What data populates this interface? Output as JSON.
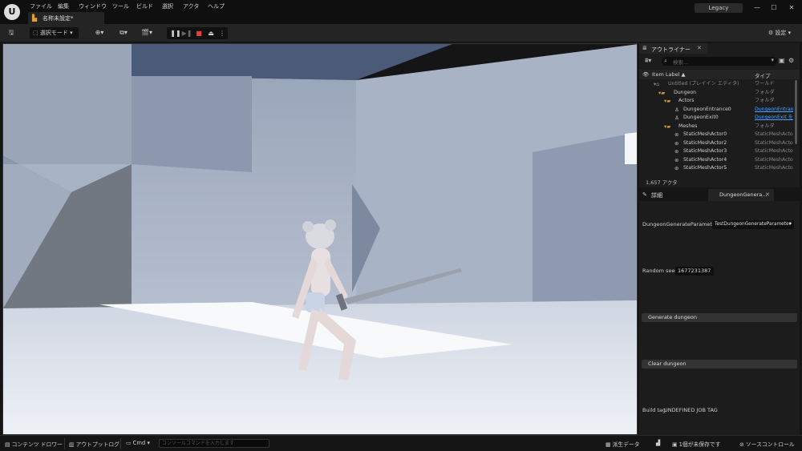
{
  "menu": [
    "ファイル",
    "編集",
    "ウィンドウ",
    "ツール",
    "ビルド",
    "選択",
    "アクタ",
    "ヘルプ"
  ],
  "document_tab": "名称未設定*",
  "legacy_label": "Legacy",
  "toolbar": {
    "mode_label": "選択モード",
    "settings_label": "設定"
  },
  "outliner": {
    "tab_label": "アウトライナー",
    "search_placeholder": "検索...",
    "col_label": "Item Label ▲",
    "col_type": "タイプ",
    "rows": [
      {
        "label": "Untitled (プレイイン エディタ)",
        "type": "ワールド",
        "icon": "world-icon"
      },
      {
        "label": "Dungeon",
        "type": "フォルダ",
        "icon": "folder-icon"
      },
      {
        "label": "Actors",
        "type": "フォルダ",
        "icon": "folder-icon"
      },
      {
        "label": "DungeonEntrance0",
        "type": "DungeonEntranc",
        "icon": "actor-icon"
      },
      {
        "label": "DungeonExit0",
        "type": "DungeonExit を",
        "icon": "actor-icon"
      },
      {
        "label": "Meshes",
        "type": "フォルダ",
        "icon": "folder-icon"
      },
      {
        "label": "StaticMeshActor0",
        "type": "StaticMeshActo",
        "icon": "mesh-icon"
      },
      {
        "label": "StaticMeshActor2",
        "type": "StaticMeshActo",
        "icon": "mesh-icon"
      },
      {
        "label": "StaticMeshActor3",
        "type": "StaticMeshActo",
        "icon": "mesh-icon"
      },
      {
        "label": "StaticMeshActor4",
        "type": "StaticMeshActo",
        "icon": "mesh-icon"
      },
      {
        "label": "StaticMeshActor5",
        "type": "StaticMeshActo",
        "icon": "mesh-icon"
      }
    ],
    "actor_count": "1,657 アクタ"
  },
  "details": {
    "tab_details": "詳細",
    "tab_component": "DungeonGenera...",
    "param_label": "DungeonGenerateParameter",
    "param_value": "TestDungeonGenerateParameter",
    "seed_label": "Random seed",
    "seed_value": "1677231387",
    "generate_btn": "Generate dungeon",
    "clear_btn": "Clear dungeon",
    "build_tag_label": "Build tag",
    "build_tag_value": "UNDEFINED JOB TAG"
  },
  "statusbar": {
    "content_drawer": "コンテンツ ドロワー",
    "output_log": "アウトプットログ",
    "cmd": "Cmd",
    "console_placeholder": "コンソールコマンドを入力します",
    "derived_data": "派生データ",
    "unsaved": "1個が未保存です",
    "source_control": "ソースコントロール"
  },
  "colors": {
    "accent_play_stop": "#e04040",
    "link": "#4da3ff",
    "folder": "#d3a04a"
  }
}
